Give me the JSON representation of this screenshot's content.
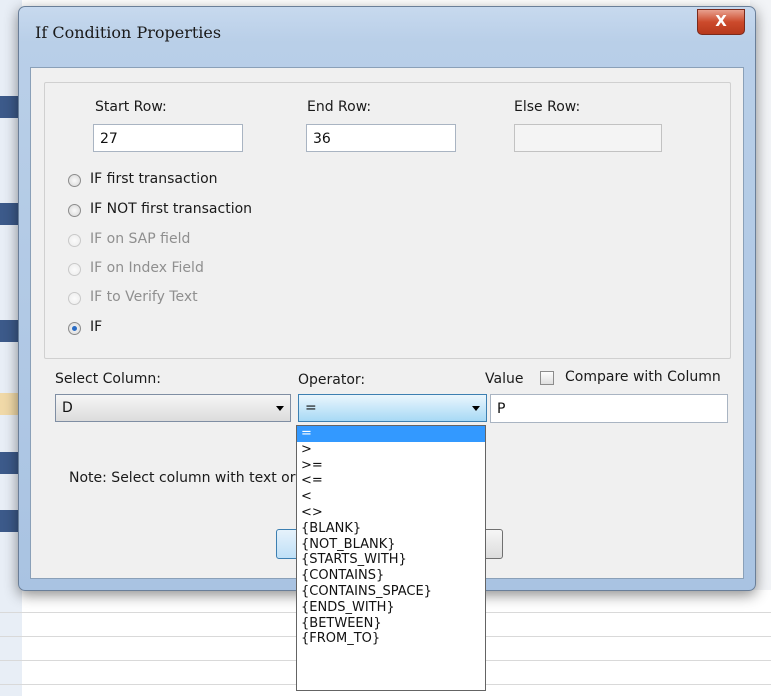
{
  "dialog": {
    "title": "If Condition Properties",
    "close_label": "X"
  },
  "rows": {
    "start_label": "Start Row:",
    "start_value": "27",
    "end_label": "End Row:",
    "end_value": "36",
    "else_label": "Else Row:",
    "else_value": ""
  },
  "conditions": [
    {
      "label": "IF first transaction",
      "checked": false,
      "enabled": true
    },
    {
      "label": "IF NOT first transaction",
      "checked": false,
      "enabled": true
    },
    {
      "label": "IF on SAP field",
      "checked": false,
      "enabled": false
    },
    {
      "label": "IF on Index Field",
      "checked": false,
      "enabled": false
    },
    {
      "label": "IF to Verify Text",
      "checked": false,
      "enabled": false
    },
    {
      "label": "IF",
      "checked": true,
      "enabled": true
    }
  ],
  "filter": {
    "select_column_label": "Select Column:",
    "select_column_value": "D",
    "operator_label": "Operator:",
    "operator_value": "=",
    "value_label": "Value",
    "value_text": "P",
    "compare_label": "Compare with Column"
  },
  "note": "Note: Select column with text or r",
  "operator_options": [
    "=",
    ">",
    ">=",
    "<=",
    "<",
    "<>",
    "{BLANK}",
    "{NOT_BLANK}",
    "{STARTS_WITH}",
    "{CONTAINS}",
    "{CONTAINS_SPACE}",
    "{ENDS_WITH}",
    "{BETWEEN}",
    "{FROM_TO}"
  ],
  "colors": {
    "selection": "#3399ff",
    "radio_checked": "#2a6cc4",
    "close_button": "#cc4a2c"
  }
}
